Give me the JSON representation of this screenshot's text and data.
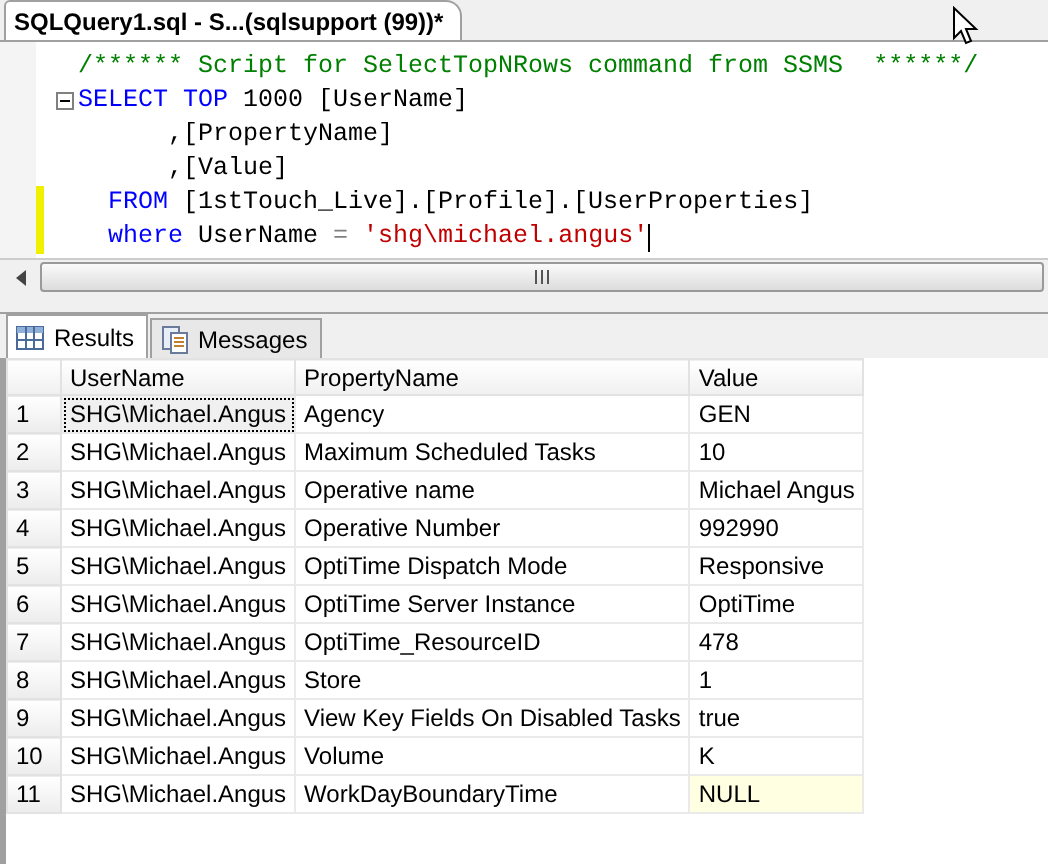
{
  "document_tab": {
    "title": "SQLQuery1.sql - S...(sqlsupport (99))*",
    "selected": true
  },
  "editor": {
    "lines": [
      {
        "changed": false,
        "fold": false,
        "tokens": [
          {
            "kind": "comment",
            "text": "/****** Script for SelectTopNRows command from SSMS  ******/"
          }
        ]
      },
      {
        "changed": false,
        "fold": true,
        "tokens": [
          {
            "kind": "keyword",
            "text": "SELECT"
          },
          {
            "kind": "keyword",
            "text": " TOP"
          },
          {
            "kind": "plain",
            "text": " 1000 [UserName]"
          }
        ]
      },
      {
        "changed": false,
        "fold": false,
        "tokens": [
          {
            "kind": "plain",
            "text": "      ,[PropertyName]"
          }
        ]
      },
      {
        "changed": false,
        "fold": false,
        "tokens": [
          {
            "kind": "plain",
            "text": "      ,[Value]"
          }
        ]
      },
      {
        "changed": true,
        "fold": false,
        "tokens": [
          {
            "kind": "keyword",
            "text": "  FROM"
          },
          {
            "kind": "plain",
            "text": " [1stTouch_Live].[Profile].[UserProperties]"
          }
        ]
      },
      {
        "changed": true,
        "fold": false,
        "caret": true,
        "tokens": [
          {
            "kind": "keyword",
            "text": "  where"
          },
          {
            "kind": "plain",
            "text": " UserName "
          },
          {
            "kind": "operator",
            "text": "="
          },
          {
            "kind": "string",
            "text": " 'shg\\michael.angus'"
          }
        ]
      }
    ]
  },
  "result_tabs": [
    {
      "label": "Results",
      "selected": true
    },
    {
      "label": "Messages",
      "selected": false
    }
  ],
  "table": {
    "columns": [
      "UserName",
      "PropertyName",
      "Value"
    ],
    "rows": [
      {
        "number": "1",
        "cells": [
          "SHG\\Michael.Angus",
          "Agency",
          "GEN"
        ],
        "focused": true,
        "null_value": false
      },
      {
        "number": "2",
        "cells": [
          "SHG\\Michael.Angus",
          "Maximum Scheduled Tasks",
          "10"
        ],
        "focused": false,
        "null_value": false
      },
      {
        "number": "3",
        "cells": [
          "SHG\\Michael.Angus",
          "Operative name",
          "Michael Angus"
        ],
        "focused": false,
        "null_value": false
      },
      {
        "number": "4",
        "cells": [
          "SHG\\Michael.Angus",
          "Operative Number",
          "992990"
        ],
        "focused": false,
        "null_value": false
      },
      {
        "number": "5",
        "cells": [
          "SHG\\Michael.Angus",
          "OptiTime Dispatch Mode",
          "Responsive"
        ],
        "focused": false,
        "null_value": false
      },
      {
        "number": "6",
        "cells": [
          "SHG\\Michael.Angus",
          "OptiTime Server Instance",
          "OptiTime"
        ],
        "focused": false,
        "null_value": false
      },
      {
        "number": "7",
        "cells": [
          "SHG\\Michael.Angus",
          "OptiTime_ResourceID",
          "478"
        ],
        "focused": false,
        "null_value": false
      },
      {
        "number": "8",
        "cells": [
          "SHG\\Michael.Angus",
          "Store",
          "1"
        ],
        "focused": false,
        "null_value": false
      },
      {
        "number": "9",
        "cells": [
          "SHG\\Michael.Angus",
          "View Key Fields On Disabled Tasks",
          "true"
        ],
        "focused": false,
        "null_value": false
      },
      {
        "number": "10",
        "cells": [
          "SHG\\Michael.Angus",
          "Volume",
          "K"
        ],
        "focused": false,
        "null_value": false
      },
      {
        "number": "11",
        "cells": [
          "SHG\\Michael.Angus",
          "WorkDayBoundaryTime",
          "NULL"
        ],
        "focused": false,
        "null_value": true
      }
    ]
  }
}
